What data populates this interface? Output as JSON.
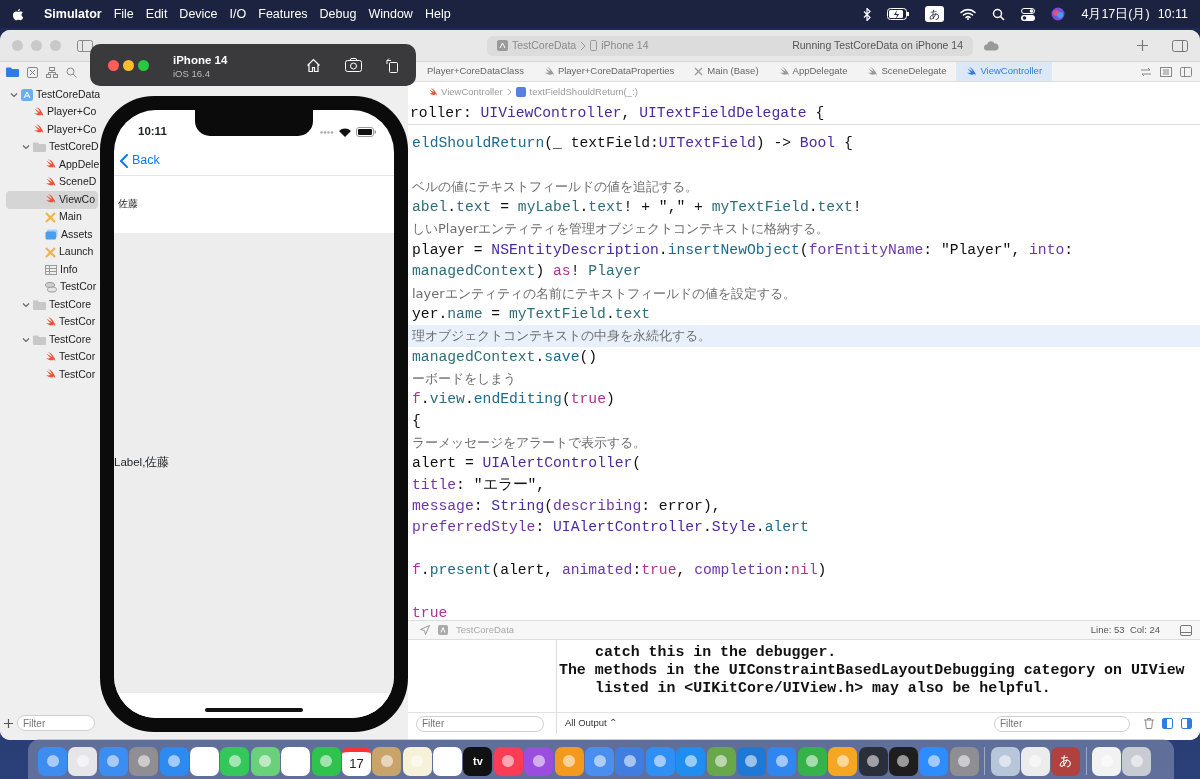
{
  "menu_bar": {
    "app": "Simulator",
    "menus": [
      "File",
      "Edit",
      "Device",
      "I/O",
      "Features",
      "Debug",
      "Window",
      "Help"
    ],
    "input_mode": "あ",
    "date": "4月17日(月)",
    "time": "10:11"
  },
  "xcode": {
    "scheme": {
      "project": "TestCoreData",
      "device": "iPhone 14",
      "status": "Running TestCoreData on iPhone 14"
    },
    "tabs": [
      {
        "label": "Player+CoreDataClass",
        "selected": false
      },
      {
        "label": "Player+CoreDataProperties",
        "kind": "swift",
        "selected": false
      },
      {
        "label": "Main (Base)",
        "kind": "storyboard",
        "selected": false
      },
      {
        "label": "AppDelegate",
        "kind": "swift",
        "selected": false
      },
      {
        "label": "SceneDelegate",
        "kind": "swift",
        "selected": false
      },
      {
        "label": "ViewController",
        "kind": "swift",
        "selected": true
      }
    ],
    "breadcrumb": [
      "ViewController",
      "textFieldShouldReturn(_:)"
    ],
    "navigator": [
      {
        "label": "TestCoreData",
        "kind": "project",
        "expanded": true,
        "selected": false,
        "children": [
          {
            "label": "Player+Co",
            "kind": "swift",
            "selected": false
          },
          {
            "label": "Player+Co",
            "kind": "swift",
            "selected": false
          },
          {
            "label": "TestCoreD",
            "kind": "folder",
            "expanded": true,
            "selected": false,
            "children": [
              {
                "label": "AppDele",
                "kind": "swift",
                "selected": false
              },
              {
                "label": "SceneD",
                "kind": "swift",
                "selected": false
              },
              {
                "label": "ViewCo",
                "kind": "swift",
                "selected": true
              },
              {
                "label": "Main",
                "kind": "storyboard",
                "selected": false
              },
              {
                "label": "Assets",
                "kind": "assets",
                "selected": false
              },
              {
                "label": "Launch",
                "kind": "storyboard",
                "selected": false
              },
              {
                "label": "Info",
                "kind": "plist",
                "selected": false
              },
              {
                "label": "TestCor",
                "kind": "model",
                "selected": false
              }
            ]
          },
          {
            "label": "TestCore",
            "kind": "folder",
            "expanded": true,
            "selected": false,
            "children": [
              {
                "label": "TestCor",
                "kind": "swift",
                "selected": false
              }
            ]
          },
          {
            "label": "TestCore",
            "kind": "folder",
            "expanded": true,
            "selected": false,
            "children": [
              {
                "label": "TestCor",
                "kind": "swift",
                "selected": false
              },
              {
                "label": "TestCor",
                "kind": "swift",
                "selected": false
              }
            ]
          }
        ]
      }
    ],
    "navigator_filter": {
      "placeholder": "Filter"
    },
    "sticky_line": [
      {
        "t": "roller: ",
        "kind": "plain"
      },
      {
        "t": "UIViewController",
        "kind": "type"
      },
      {
        "t": ", ",
        "kind": "plain"
      },
      {
        "t": "UITextFieldDelegate",
        "kind": "type"
      },
      {
        "t": " {",
        "kind": "plain"
      }
    ],
    "code": [
      {
        "kind": "code",
        "current": false,
        "tokens": [
          {
            "t": "eldShouldReturn",
            "kind": "fn"
          },
          {
            "t": "(_ textField:",
            "kind": "plain"
          },
          {
            "t": "UITextField",
            "kind": "type"
          },
          {
            "t": ") -> ",
            "kind": "plain"
          },
          {
            "t": "Bool",
            "kind": "type"
          },
          {
            "t": " {",
            "kind": "plain"
          }
        ]
      },
      {
        "kind": "blank"
      },
      {
        "kind": "comment",
        "current": false,
        "text": "ベルの値にテキストフィールドの値を追記する。"
      },
      {
        "kind": "code",
        "current": false,
        "tokens": [
          {
            "t": "abel",
            "kind": "prop"
          },
          {
            "t": ".",
            "kind": "plain"
          },
          {
            "t": "text",
            "kind": "prop"
          },
          {
            "t": " = ",
            "kind": "plain"
          },
          {
            "t": "myLabel",
            "kind": "prop"
          },
          {
            "t": ".",
            "kind": "plain"
          },
          {
            "t": "text",
            "kind": "prop"
          },
          {
            "t": "! + \",\" + ",
            "kind": "plain"
          },
          {
            "t": "myTextField",
            "kind": "prop"
          },
          {
            "t": ".",
            "kind": "plain"
          },
          {
            "t": "text",
            "kind": "prop"
          },
          {
            "t": "!",
            "kind": "plain"
          }
        ]
      },
      {
        "kind": "comment",
        "current": false,
        "text": "しいPlayerエンティティを管理オブジェクトコンテキストに格納する。"
      },
      {
        "kind": "code",
        "current": false,
        "tokens": [
          {
            "t": "player = ",
            "kind": "plain"
          },
          {
            "t": "NSEntityDescription",
            "kind": "type"
          },
          {
            "t": ".",
            "kind": "plain"
          },
          {
            "t": "insertNewObject",
            "kind": "fn"
          },
          {
            "t": "(",
            "kind": "plain"
          },
          {
            "t": "forEntityName",
            "kind": "param"
          },
          {
            "t": ": \"Player\", ",
            "kind": "plain"
          },
          {
            "t": "into",
            "kind": "param"
          },
          {
            "t": ":",
            "kind": "plain"
          }
        ]
      },
      {
        "kind": "code",
        "current": false,
        "tokens": [
          {
            "t": "managedContext",
            "kind": "prop"
          },
          {
            "t": ") ",
            "kind": "plain"
          },
          {
            "t": "as",
            "kind": "keyword"
          },
          {
            "t": "! ",
            "kind": "plain"
          },
          {
            "t": "Player",
            "kind": "prop"
          }
        ]
      },
      {
        "kind": "comment",
        "current": false,
        "text": "layerエンティティの名前にテキストフィールドの値を設定する。"
      },
      {
        "kind": "code",
        "current": false,
        "tokens": [
          {
            "t": "yer.",
            "kind": "plain"
          },
          {
            "t": "name",
            "kind": "prop"
          },
          {
            "t": " = ",
            "kind": "plain"
          },
          {
            "t": "myTextField",
            "kind": "prop"
          },
          {
            "t": ".",
            "kind": "plain"
          },
          {
            "t": "text",
            "kind": "prop"
          }
        ]
      },
      {
        "kind": "comment",
        "current": true,
        "text": "理オブジェクトコンテキストの中身を永続化する。"
      },
      {
        "kind": "code",
        "current": false,
        "tokens": [
          {
            "t": "managedContext",
            "kind": "prop"
          },
          {
            "t": ".",
            "kind": "plain"
          },
          {
            "t": "save",
            "kind": "fn"
          },
          {
            "t": "()",
            "kind": "plain"
          }
        ]
      },
      {
        "kind": "comment",
        "current": false,
        "text": "ーボードをしまう"
      },
      {
        "kind": "code",
        "current": false,
        "tokens": [
          {
            "t": "f",
            "kind": "keyword"
          },
          {
            "t": ".",
            "kind": "plain"
          },
          {
            "t": "view",
            "kind": "prop"
          },
          {
            "t": ".",
            "kind": "plain"
          },
          {
            "t": "endEditing",
            "kind": "fn"
          },
          {
            "t": "(",
            "kind": "plain"
          },
          {
            "t": "true",
            "kind": "keyword"
          },
          {
            "t": ")",
            "kind": "plain"
          }
        ]
      },
      {
        "kind": "code",
        "current": false,
        "tokens": [
          {
            "t": "{",
            "kind": "plain"
          }
        ]
      },
      {
        "kind": "comment",
        "current": false,
        "text": "ラーメッセージをアラートで表示する。"
      },
      {
        "kind": "code",
        "current": false,
        "tokens": [
          {
            "t": "alert = ",
            "kind": "plain"
          },
          {
            "t": "UIAlertController",
            "kind": "type"
          },
          {
            "t": "(",
            "kind": "plain"
          }
        ]
      },
      {
        "kind": "code",
        "current": false,
        "tokens": [
          {
            "t": "title",
            "kind": "param"
          },
          {
            "t": ": \"エラー\",",
            "kind": "plain"
          }
        ]
      },
      {
        "kind": "code",
        "current": false,
        "tokens": [
          {
            "t": "message",
            "kind": "param"
          },
          {
            "t": ": ",
            "kind": "plain"
          },
          {
            "t": "String",
            "kind": "type"
          },
          {
            "t": "(",
            "kind": "plain"
          },
          {
            "t": "describing",
            "kind": "param"
          },
          {
            "t": ": error),",
            "kind": "plain"
          }
        ]
      },
      {
        "kind": "code",
        "current": false,
        "tokens": [
          {
            "t": "preferredStyle",
            "kind": "param"
          },
          {
            "t": ": ",
            "kind": "plain"
          },
          {
            "t": "UIAlertController",
            "kind": "type"
          },
          {
            "t": ".",
            "kind": "plain"
          },
          {
            "t": "Style",
            "kind": "type"
          },
          {
            "t": ".",
            "kind": "plain"
          },
          {
            "t": "alert",
            "kind": "fn"
          }
        ]
      },
      {
        "kind": "blank"
      },
      {
        "kind": "code",
        "current": false,
        "tokens": [
          {
            "t": "f",
            "kind": "keyword"
          },
          {
            "t": ".",
            "kind": "plain"
          },
          {
            "t": "present",
            "kind": "fn"
          },
          {
            "t": "(alert, ",
            "kind": "plain"
          },
          {
            "t": "animated",
            "kind": "param"
          },
          {
            "t": ":",
            "kind": "plain"
          },
          {
            "t": "true",
            "kind": "keyword"
          },
          {
            "t": ", ",
            "kind": "plain"
          },
          {
            "t": "completion",
            "kind": "param"
          },
          {
            "t": ":",
            "kind": "plain"
          },
          {
            "t": "nil",
            "kind": "keyword"
          },
          {
            "t": ")",
            "kind": "plain"
          }
        ]
      },
      {
        "kind": "blank"
      },
      {
        "kind": "code",
        "current": false,
        "tokens": [
          {
            "t": "true",
            "kind": "keyword"
          }
        ]
      }
    ],
    "debug_bar": {
      "target": "TestCoreData",
      "position": "Line: 53  Col: 24"
    },
    "console": [
      {
        "text": "catch this in the debugger.",
        "indented": true
      },
      {
        "text": "The methods in the UIConstraintBasedLayoutDebugging category on UIView",
        "indented": false
      },
      {
        "text": "listed in <UIKitCore/UIView.h> may also be helpful.",
        "indented": true
      }
    ],
    "variables_filter": {
      "placeholder": "Filter"
    },
    "output_menu": "All Output ⌃",
    "console_filter": {
      "placeholder": "Filter"
    }
  },
  "simulator": {
    "device": "iPhone 14",
    "os": "iOS 16.4",
    "screen": {
      "time": "10:11",
      "back": "Back",
      "top_label": "佐藤",
      "center_label": "Label,佐藤"
    }
  },
  "dock": {
    "calendar_day": "17",
    "tv_label": "tv",
    "input_label": "あ"
  }
}
